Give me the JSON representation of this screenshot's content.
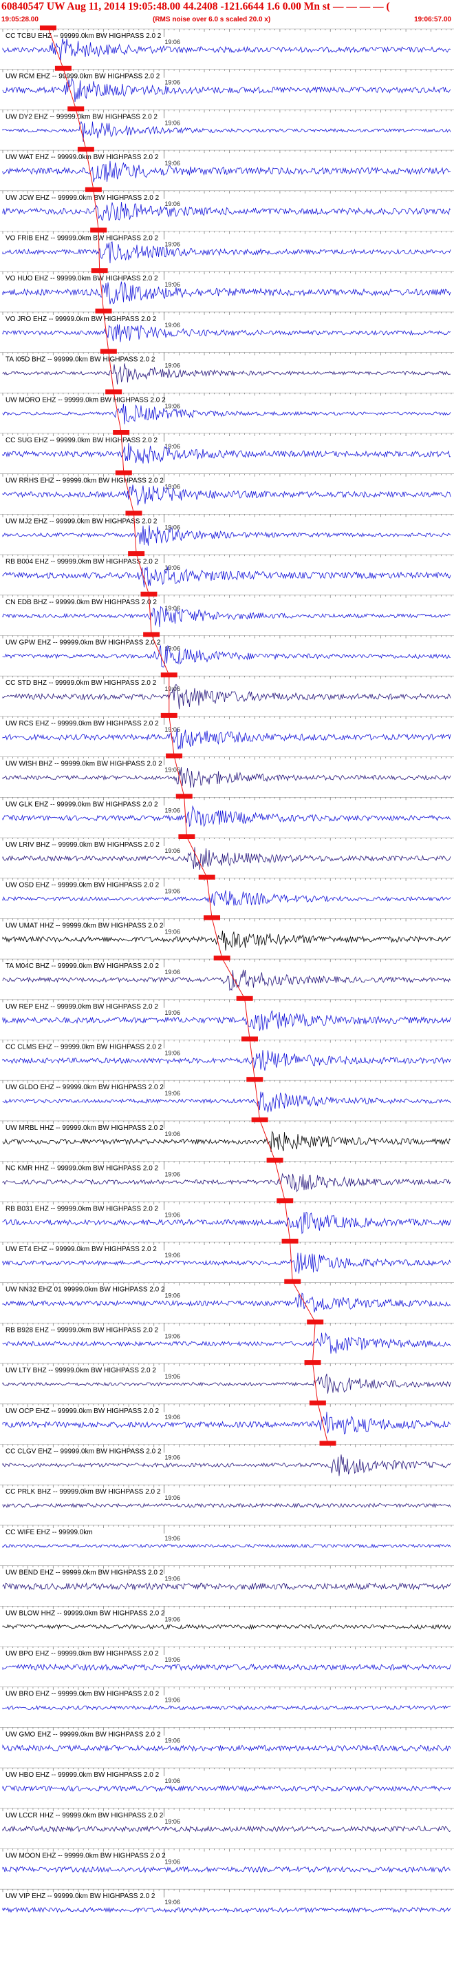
{
  "header": {
    "title": "60840547 UW Aug 11, 2014 19:05:48.00   44.2408 -121.6644  1.6 0.00 Mn st — — — — (",
    "start_time": "19:05:28.00",
    "scale_note": "(RMS noise over 6.0 s scaled 20.0 x)",
    "end_time": "19:06:57.00"
  },
  "colors": {
    "blue": "#1515d8",
    "navy": "#25157a",
    "black": "#000000",
    "pick": "#ee1111"
  },
  "chart_data": {
    "type": "line",
    "title": "60840547 UW Aug 11, 2014 19:05:48.00   44.2408 -121.6644  1.6 0.00 Mn st",
    "x_range": [
      "19:05:28.00",
      "19:06:57.00"
    ],
    "minute_tick_label": "19:06",
    "series": [
      {
        "name": "CC TCBU EHZ -- 99999.0km BW  HIGHPASS  2.0  2",
        "color": "blue",
        "pick_s": 9.0
      },
      {
        "name": "UW RCM EHZ -- 99999.0km BW  HIGHPASS  2.0  2",
        "color": "blue",
        "pick_s": 12.0
      },
      {
        "name": "UW DY2 EHZ -- 99999.0km BW  HIGHPASS  2.0  2",
        "color": "blue",
        "pick_s": 14.5
      },
      {
        "name": "UW WAT EHZ -- 99999.0km BW  HIGHPASS  2.0  2",
        "color": "blue",
        "pick_s": 16.5
      },
      {
        "name": "UW JCW EHZ -- 99999.0km BW  HIGHPASS  2.0  2",
        "color": "blue",
        "pick_s": 18.0
      },
      {
        "name": "VO FRIB EHZ -- 99999.0km BW  HIGHPASS  2.0  2",
        "color": "blue",
        "pick_s": 19.0
      },
      {
        "name": "VO HUO EHZ -- 99999.0km BW  HIGHPASS  2.0  2",
        "color": "blue",
        "pick_s": 19.2
      },
      {
        "name": "VO JRO EHZ -- 99999.0km BW  HIGHPASS  2.0  2",
        "color": "blue",
        "pick_s": 20.0
      },
      {
        "name": "TA I05D BHZ -- 99999.0km BW  HIGHPASS  2.0  2",
        "color": "navy",
        "pick_s": 21.0
      },
      {
        "name": "UW MORO EHZ -- 99999.0km BW  HIGHPASS  2.0  2",
        "color": "blue",
        "pick_s": 22.0
      },
      {
        "name": "CC SUG EHZ -- 99999.0km BW  HIGHPASS  2.0  2",
        "color": "blue",
        "pick_s": 23.5
      },
      {
        "name": "UW RRHS EHZ -- 99999.0km BW  HIGHPASS  2.0  2",
        "color": "blue",
        "pick_s": 24.0
      },
      {
        "name": "UW MJ2 EHZ -- 99999.0km BW  HIGHPASS  2.0  2",
        "color": "blue",
        "pick_s": 26.0
      },
      {
        "name": "RB B004 EHZ -- 99999.0km BW  HIGHPASS  2.0  2",
        "color": "blue",
        "pick_s": 26.5
      },
      {
        "name": "CN EDB BHZ -- 99999.0km BW  HIGHPASS  2.0  2",
        "color": "blue",
        "pick_s": 29.0
      },
      {
        "name": "UW GPW EHZ -- 99999.0km BW  HIGHPASS  2.0  2",
        "color": "blue",
        "pick_s": 29.5
      },
      {
        "name": "CC STD BHZ -- 99999.0km BW  HIGHPASS  2.0  2",
        "color": "navy",
        "pick_s": 33.0
      },
      {
        "name": "UW RCS EHZ -- 99999.0km BW  HIGHPASS  2.0  2",
        "color": "blue",
        "pick_s": 33.0
      },
      {
        "name": "UW WISH BHZ -- 99999.0km BW  HIGHPASS  2.0  2",
        "color": "navy",
        "pick_s": 34.0
      },
      {
        "name": "UW GLK EHZ -- 99999.0km BW  HIGHPASS  2.0  2",
        "color": "blue",
        "pick_s": 36.0
      },
      {
        "name": "UW LRIV BHZ -- 99999.0km BW  HIGHPASS  2.0  2",
        "color": "navy",
        "pick_s": 36.5
      },
      {
        "name": "UW OSD EHZ -- 99999.0km BW  HIGHPASS  2.0  2",
        "color": "blue",
        "pick_s": 40.5
      },
      {
        "name": "UW UMAT HHZ -- 99999.0km BW  HIGHPASS  2.0  2",
        "color": "black",
        "pick_s": 41.5
      },
      {
        "name": "TA M04C BHZ -- 99999.0km BW  HIGHPASS  2.0  2",
        "color": "navy",
        "pick_s": 43.5
      },
      {
        "name": "UW REP EHZ -- 99999.0km BW  HIGHPASS  2.0  2",
        "color": "blue",
        "pick_s": 48.0
      },
      {
        "name": "CC CLMS EHZ -- 99999.0km BW  HIGHPASS  2.0  2",
        "color": "blue",
        "pick_s": 49.0
      },
      {
        "name": "UW GLDO EHZ -- 99999.0km BW  HIGHPASS  2.0  2",
        "color": "blue",
        "pick_s": 50.0
      },
      {
        "name": "UW MRBL HHZ -- 99999.0km BW  HIGHPASS  2.0  2",
        "color": "black",
        "pick_s": 51.0
      },
      {
        "name": "NC KMR HHZ -- 99999.0km BW  HIGHPASS  2.0  2",
        "color": "navy",
        "pick_s": 54.0
      },
      {
        "name": "RB B031 EHZ -- 99999.0km BW  HIGHPASS  2.0  2",
        "color": "blue",
        "pick_s": 56.0
      },
      {
        "name": "UW ET4 EHZ -- 99999.0km BW  HIGHPASS  2.0  2",
        "color": "blue",
        "pick_s": 57.0
      },
      {
        "name": "UW NN32 EHZ 01 99999.0km BW  HIGHPASS  2.0  2",
        "color": "blue",
        "pick_s": 57.5
      },
      {
        "name": "RB B928 EHZ -- 99999.0km BW  HIGHPASS  2.0  2",
        "color": "blue",
        "pick_s": 62.0
      },
      {
        "name": "UW LTY BHZ -- 99999.0km BW  HIGHPASS  2.0  2",
        "color": "navy",
        "pick_s": 61.5
      },
      {
        "name": "UW OCP EHZ -- 99999.0km BW  HIGHPASS  2.0  2",
        "color": "blue",
        "pick_s": 62.5
      },
      {
        "name": "CC CLGV EHZ -- 99999.0km BW  HIGHPASS  2.0  2",
        "color": "navy",
        "pick_s": 64.5
      },
      {
        "name": "CC PRLK BHZ -- 99999.0km BW  HIGHPASS  2.0  2",
        "color": "navy",
        "pick_s": null
      },
      {
        "name": "CC WIFE EHZ -- 99999.0km",
        "color": "blue",
        "pick_s": null
      },
      {
        "name": "UW BEND EHZ -- 99999.0km BW  HIGHPASS  2.0  2",
        "color": "navy",
        "pick_s": null
      },
      {
        "name": "UW BLOW HHZ -- 99999.0km BW  HIGHPASS  2.0  2",
        "color": "black",
        "pick_s": null
      },
      {
        "name": "UW BPO EHZ -- 99999.0km BW  HIGHPASS  2.0  2",
        "color": "blue",
        "pick_s": null
      },
      {
        "name": "UW BRO EHZ -- 99999.0km BW  HIGHPASS  2.0  2",
        "color": "blue",
        "pick_s": null
      },
      {
        "name": "UW GMO EHZ -- 99999.0km BW  HIGHPASS  2.0  2",
        "color": "blue",
        "pick_s": null
      },
      {
        "name": "UW HBO EHZ -- 99999.0km BW  HIGHPASS  2.0  2",
        "color": "blue",
        "pick_s": null
      },
      {
        "name": "UW LCCR HHZ -- 99999.0km BW  HIGHPASS  2.0  2",
        "color": "navy",
        "pick_s": null
      },
      {
        "name": "UW MOON EHZ -- 99999.0km BW  HIGHPASS  2.0  2",
        "color": "blue",
        "pick_s": null
      },
      {
        "name": "UW VIP EHZ -- 99999.0km BW  HIGHPASS  2.0  2",
        "color": "blue",
        "pick_s": null
      }
    ]
  }
}
